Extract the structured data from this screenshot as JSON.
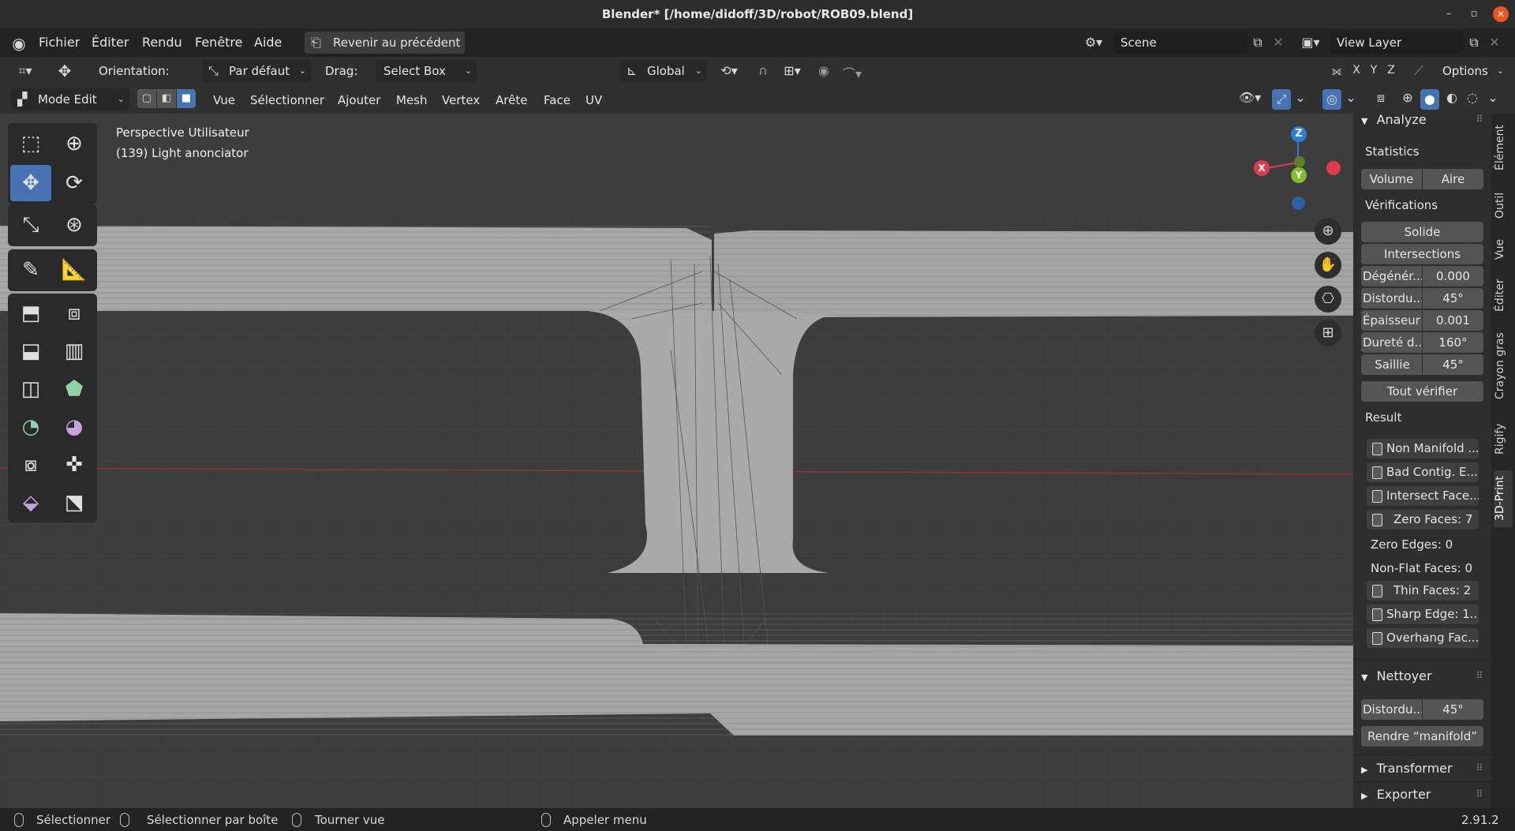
{
  "window": {
    "title": "Blender* [/home/didoff/3D/robot/ROB09.blend]"
  },
  "menubar": {
    "items": [
      "Fichier",
      "Éditer",
      "Rendu",
      "Fenêtre",
      "Aide"
    ],
    "back_button": "Revenir au précédent",
    "scene": "Scene",
    "view_layer": "View Layer"
  },
  "tool_header": {
    "orientation_label": "Orientation:",
    "orientation_value": "Par défaut",
    "drag_label": "Drag:",
    "drag_value": "Select Box",
    "transform_orientation": "Global",
    "axes": [
      "X",
      "Y",
      "Z"
    ],
    "options": "Options"
  },
  "mode_header": {
    "mode": "Mode Edit",
    "menus": [
      "Vue",
      "Sélectionner",
      "Ajouter",
      "Mesh",
      "Vertex",
      "Arête",
      "Face",
      "UV"
    ]
  },
  "viewport": {
    "view_name": "Perspective Utilisateur",
    "object_info": "(139) Light anonciator",
    "gizmo": {
      "x": "X",
      "y": "Y",
      "z": "Z"
    }
  },
  "npanel": {
    "analyze": {
      "title": "Analyze",
      "statistics_label": "Statistics",
      "volume": "Volume",
      "area": "Aire",
      "checks_label": "Vérifications",
      "solid": "Solide",
      "intersections": "Intersections",
      "rows": [
        {
          "label": "Dégénér...",
          "value": "0.000"
        },
        {
          "label": "Distordu...",
          "value": "45°"
        },
        {
          "label": "Épaisseur",
          "value": "0.001"
        },
        {
          "label": "Dureté d...",
          "value": "160°"
        },
        {
          "label": "Saillie",
          "value": "45°"
        }
      ],
      "check_all": "Tout vérifier",
      "result_label": "Result",
      "result_buttons_a": [
        "Non Manifold ...",
        "Bad Contig. E...",
        "Intersect Face...",
        "Zero Faces: 7"
      ],
      "zero_edges": "Zero Edges: 0",
      "non_flat": "Non-Flat Faces: 0",
      "result_buttons_b": [
        "Thin Faces: 2",
        "Sharp Edge: 1...",
        "Overhang Fac..."
      ]
    },
    "cleanup": {
      "title": "Nettoyer",
      "distort_label": "Distordu...",
      "distort_value": "45°",
      "make_manifold": "Rendre “manifold”"
    },
    "transform_title": "Transformer",
    "export_title": "Exporter",
    "tabs": [
      "Élément",
      "Outil",
      "Vue",
      "Éditer",
      "Crayon gras",
      "Rigify",
      "3D-Print"
    ]
  },
  "statusbar": {
    "select": "Sélectionner",
    "box_select": "Sélectionner par boîte",
    "rotate_view": "Tourner vue",
    "call_menu": "Appeler menu",
    "version": "2.91.2"
  }
}
